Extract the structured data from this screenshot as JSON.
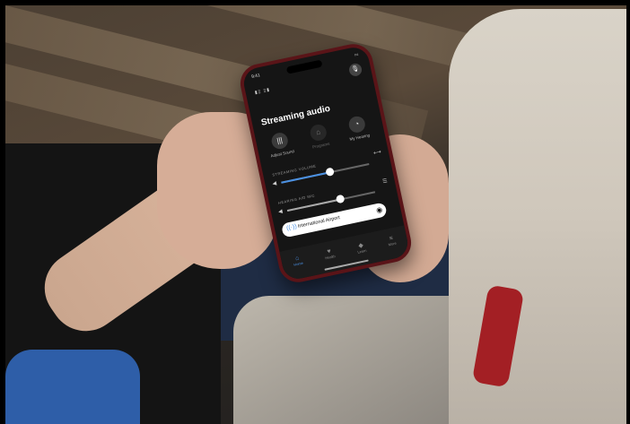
{
  "phone": {
    "status_time": "9:41",
    "battery_icon": "battery-icon",
    "devices_indicator": "▮▯ ▯▮",
    "mic_icon": "microphone-icon",
    "mic_glyph": "🎙",
    "title": "Streaming audio",
    "quick_actions": [
      {
        "label": "Adjust Sound",
        "icon": "equalizer-icon",
        "glyph": "|||"
      },
      {
        "label": "Programs",
        "icon": "programs-icon",
        "glyph": "⌂"
      },
      {
        "label": "My Hearing",
        "icon": "hearing-icon",
        "glyph": "◔"
      }
    ],
    "streaming_volume_label": "STREAMING VOLUME",
    "streaming_volume_level": 0.55,
    "hearing_aid_label": "HEARING AID MIC",
    "hearing_aid_level": 0.6,
    "volume_icon_glyph": "◀",
    "link_icon_glyph": "⟷",
    "balance_icon_glyph": "☰",
    "airport_icon_glyph": "((·))",
    "airport_label": "International Airport",
    "airport_rec_glyph": "◉",
    "tabs": [
      {
        "label": "Home",
        "glyph": "⌂",
        "active": true
      },
      {
        "label": "Health",
        "glyph": "♥",
        "active": false
      },
      {
        "label": "Learn",
        "glyph": "◆",
        "active": false
      },
      {
        "label": "More",
        "glyph": "≡",
        "active": false
      }
    ],
    "accent_color": "#4a90e2",
    "case_color": "#5a1418"
  }
}
